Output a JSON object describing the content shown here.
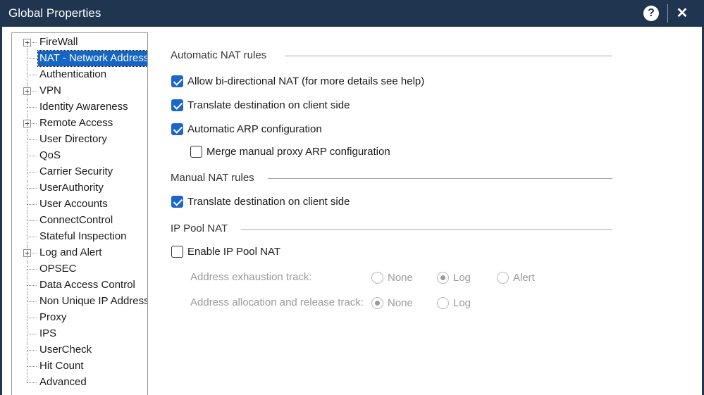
{
  "window": {
    "title": "Global Properties",
    "help_label": "?",
    "close_label": "✕"
  },
  "tree": {
    "items": [
      {
        "label": "FireWall",
        "expandable": true,
        "expander": "+"
      },
      {
        "label": "NAT - Network Address Translation",
        "expandable": false,
        "selected": true
      },
      {
        "label": "Authentication",
        "expandable": false
      },
      {
        "label": "VPN",
        "expandable": true,
        "expander": "+"
      },
      {
        "label": "Identity Awareness",
        "expandable": false
      },
      {
        "label": "Remote Access",
        "expandable": true,
        "expander": "+"
      },
      {
        "label": "User Directory",
        "expandable": false
      },
      {
        "label": "QoS",
        "expandable": false
      },
      {
        "label": "Carrier Security",
        "expandable": false
      },
      {
        "label": "UserAuthority",
        "expandable": false
      },
      {
        "label": "User Accounts",
        "expandable": false
      },
      {
        "label": "ConnectControl",
        "expandable": false
      },
      {
        "label": "Stateful Inspection",
        "expandable": false
      },
      {
        "label": "Log and Alert",
        "expandable": true,
        "expander": "+"
      },
      {
        "label": "OPSEC",
        "expandable": false
      },
      {
        "label": "Data Access Control",
        "expandable": false
      },
      {
        "label": "Non Unique IP Address Ranges",
        "expandable": false
      },
      {
        "label": "Proxy",
        "expandable": false
      },
      {
        "label": "IPS",
        "expandable": false
      },
      {
        "label": "UserCheck",
        "expandable": false
      },
      {
        "label": "Hit Count",
        "expandable": false
      },
      {
        "label": "Advanced",
        "expandable": false
      }
    ]
  },
  "automatic_nat": {
    "title": "Automatic NAT rules",
    "allow_bidirectional": {
      "label": "Allow bi-directional NAT  (for more details see help)",
      "checked": true
    },
    "translate_destination": {
      "label": "Translate destination on client side",
      "checked": true
    },
    "automatic_arp": {
      "label": "Automatic ARP configuration",
      "checked": true
    },
    "merge_proxy_arp": {
      "label": "Merge manual proxy ARP configuration",
      "checked": false
    }
  },
  "manual_nat": {
    "title": "Manual NAT rules",
    "translate_destination": {
      "label": "Translate destination on client side",
      "checked": true
    }
  },
  "ip_pool": {
    "title": "IP Pool NAT",
    "enable": {
      "label": "Enable IP Pool NAT",
      "checked": false
    },
    "exhaustion_track": {
      "label": "Address exhaustion track:",
      "options": [
        "None",
        "Log",
        "Alert"
      ],
      "selected": "Log"
    },
    "allocation_track": {
      "label": "Address allocation and release track:",
      "options": [
        "None",
        "Log"
      ],
      "selected": "None"
    }
  }
}
